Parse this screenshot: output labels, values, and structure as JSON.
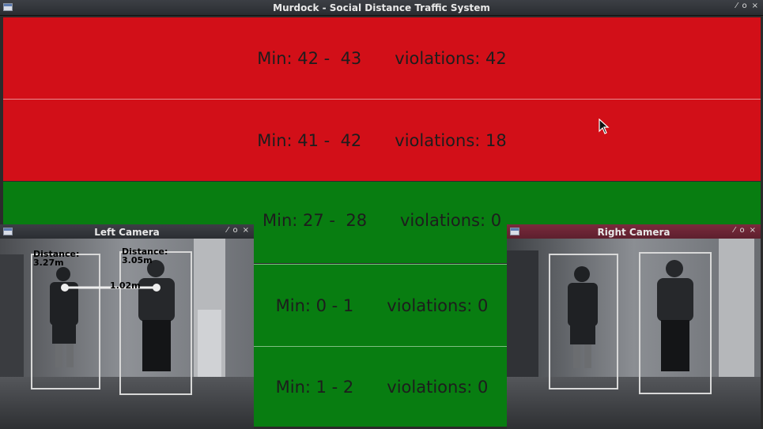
{
  "main_window": {
    "title": "Murdock - Social Distance Traffic System",
    "controls": [
      "⁄",
      "o",
      "×"
    ],
    "rows": [
      {
        "min": "Min: 42 -  43",
        "violations": "violations: 42",
        "status": "red"
      },
      {
        "min": "Min: 41 -  42",
        "violations": "violations: 18",
        "status": "red"
      },
      {
        "min": "Min: 27 -  28",
        "violations": "violations: 0",
        "status": "green"
      },
      {
        "min": "Min: 0 - 1",
        "violations": "violations: 0",
        "status": "green"
      },
      {
        "min": "Min: 1 - 2",
        "violations": "violations: 0",
        "status": "green"
      }
    ]
  },
  "left_camera": {
    "title": "Left Camera",
    "controls": [
      "⁄",
      "o",
      "×"
    ],
    "person1_distance_label": "Distance:",
    "person1_distance_value": "3.27m",
    "person2_distance_label": "Distance:",
    "person2_distance_value": "3.05m",
    "separation_value": "1.02m"
  },
  "right_camera": {
    "title": "Right Camera",
    "controls": [
      "⁄",
      "o",
      "×"
    ]
  },
  "colors": {
    "violation_red": "#d20f18",
    "safe_green": "#087d11"
  }
}
